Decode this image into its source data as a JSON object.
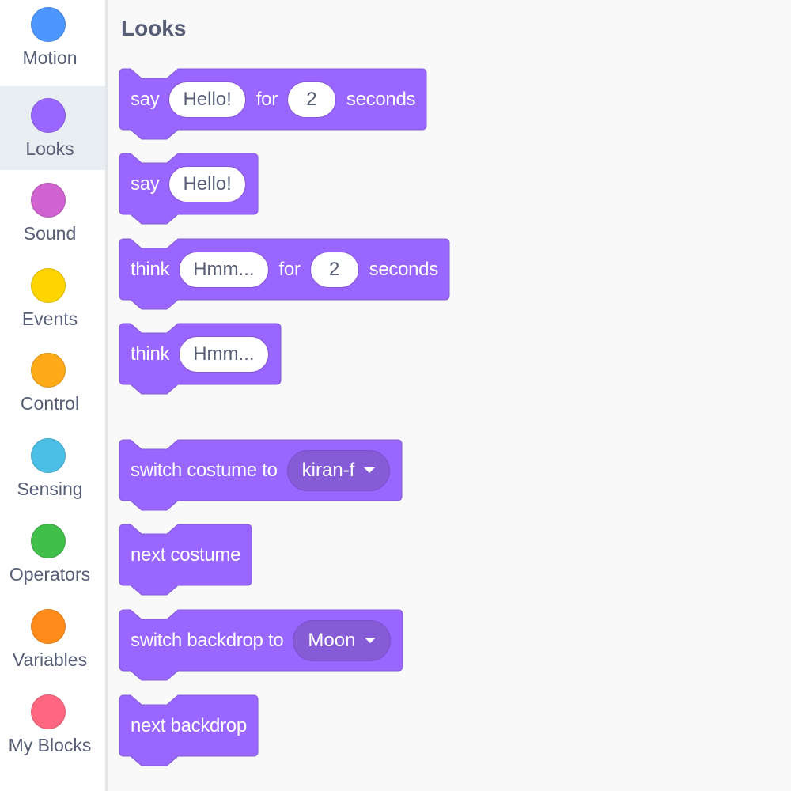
{
  "sidebar": {
    "categories": [
      {
        "label": "Motion",
        "color": "#4c97ff",
        "selected": false
      },
      {
        "label": "Looks",
        "color": "#9966ff",
        "selected": true
      },
      {
        "label": "Sound",
        "color": "#cf63cf",
        "selected": false
      },
      {
        "label": "Events",
        "color": "#ffd500",
        "selected": false
      },
      {
        "label": "Control",
        "color": "#ffab19",
        "selected": false
      },
      {
        "label": "Sensing",
        "color": "#4cbfe6",
        "selected": false
      },
      {
        "label": "Operators",
        "color": "#40bf4a",
        "selected": false
      },
      {
        "label": "Variables",
        "color": "#ff8c1a",
        "selected": false
      },
      {
        "label": "My Blocks",
        "color": "#ff6680",
        "selected": false
      }
    ]
  },
  "palette": {
    "title": "Looks",
    "block_color": "#9966ff",
    "blocks": [
      {
        "id": "say-for-secs",
        "parts": [
          {
            "type": "text",
            "value": "say"
          },
          {
            "type": "input",
            "value": "Hello!"
          },
          {
            "type": "text",
            "value": "for"
          },
          {
            "type": "number",
            "value": "2"
          },
          {
            "type": "text",
            "value": "seconds"
          }
        ]
      },
      {
        "id": "say",
        "parts": [
          {
            "type": "text",
            "value": "say"
          },
          {
            "type": "input",
            "value": "Hello!"
          }
        ]
      },
      {
        "id": "think-for-secs",
        "parts": [
          {
            "type": "text",
            "value": "think"
          },
          {
            "type": "input",
            "value": "Hmm..."
          },
          {
            "type": "text",
            "value": "for"
          },
          {
            "type": "number",
            "value": "2"
          },
          {
            "type": "text",
            "value": "seconds"
          }
        ]
      },
      {
        "id": "think",
        "parts": [
          {
            "type": "text",
            "value": "think"
          },
          {
            "type": "input",
            "value": "Hmm..."
          }
        ]
      },
      {
        "id": "switch-costume",
        "parts": [
          {
            "type": "text",
            "value": "switch costume to"
          },
          {
            "type": "dropdown",
            "value": "kiran-f"
          }
        ]
      },
      {
        "id": "next-costume",
        "parts": [
          {
            "type": "text",
            "value": "next costume"
          }
        ]
      },
      {
        "id": "switch-backdrop",
        "parts": [
          {
            "type": "text",
            "value": "switch backdrop to"
          },
          {
            "type": "dropdown",
            "value": "Moon"
          }
        ]
      },
      {
        "id": "next-backdrop",
        "parts": [
          {
            "type": "text",
            "value": "next backdrop"
          }
        ]
      }
    ]
  }
}
